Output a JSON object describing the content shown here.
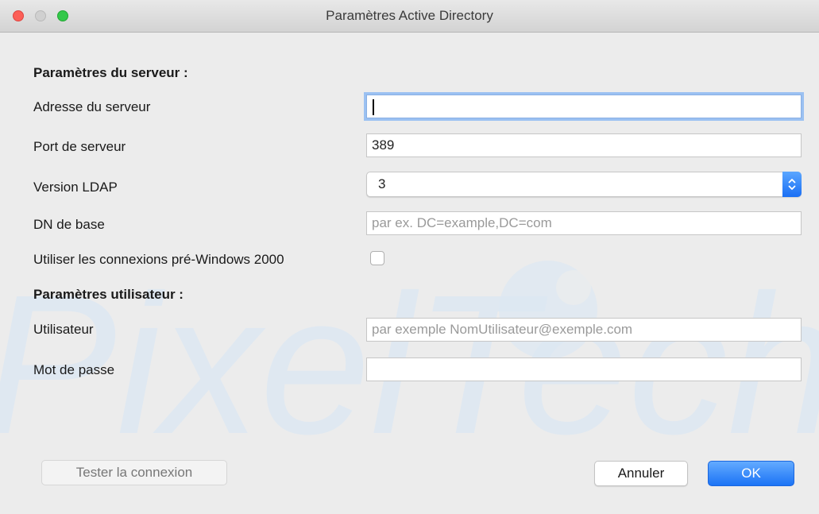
{
  "window": {
    "title": "Paramètres Active Directory"
  },
  "server_section": {
    "title": "Paramètres du serveur :",
    "address_label": "Adresse du serveur",
    "address_value": "",
    "port_label": "Port de serveur",
    "port_value": "389",
    "ldap_label": "Version LDAP",
    "ldap_value": "3",
    "basedn_label": "DN de base",
    "basedn_placeholder": "par ex. DC=example,DC=com",
    "prewin_label": "Utiliser les connexions pré-Windows 2000",
    "prewin_checked": false
  },
  "user_section": {
    "title": "Paramètres utilisateur :",
    "user_label": "Utilisateur",
    "user_placeholder": "par exemple NomUtilisateur@exemple.com",
    "password_label": "Mot de passe",
    "password_value": ""
  },
  "buttons": {
    "test": "Tester la connexion",
    "cancel": "Annuler",
    "ok": "OK"
  },
  "watermark": {
    "text": "PixelTech"
  }
}
